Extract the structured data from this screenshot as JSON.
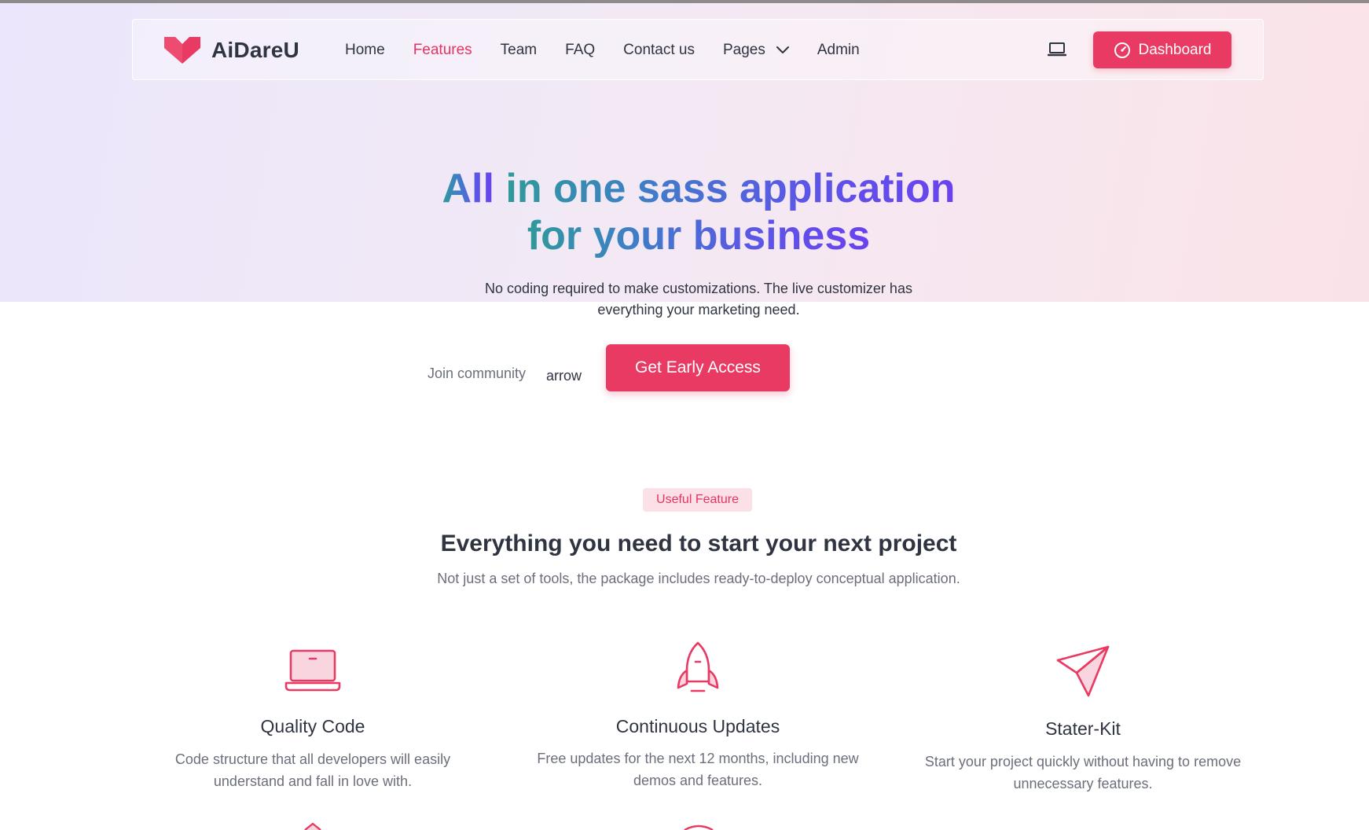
{
  "brand": {
    "name": "AiDareU",
    "accent": "#e83a62"
  },
  "nav": {
    "items": [
      {
        "label": "Home",
        "active": false
      },
      {
        "label": "Features",
        "active": true
      },
      {
        "label": "Team",
        "active": false
      },
      {
        "label": "FAQ",
        "active": false
      },
      {
        "label": "Contact us",
        "active": false
      },
      {
        "label": "Pages",
        "active": false,
        "dropdown": true
      },
      {
        "label": "Admin",
        "active": false
      }
    ],
    "device_icon": "laptop-icon",
    "dashboard_label": "Dashboard",
    "dashboard_icon": "gauge-icon"
  },
  "hero": {
    "title_line1_part1": "All",
    "title_line1_part2": "in one sass application",
    "title_line2": "for your business",
    "subtitle_line1": "No coding required to make customizations. The live customizer has",
    "subtitle_line2": "everything your marketing need.",
    "join_label": "Join community",
    "arrow_label": "arrow",
    "cta_label": "Get Early Access"
  },
  "features": {
    "badge": "Useful Feature",
    "title_bold": "Everything you need",
    "title_rest": "to start your next project",
    "subtitle": "Not just a set of tools, the package includes ready-to-deploy conceptual application.",
    "items": [
      {
        "icon": "laptop-icon",
        "title": "Quality Code",
        "desc_line1": "Code structure that all developers will easily",
        "desc_line2": "understand and fall in love with."
      },
      {
        "icon": "rocket-icon",
        "title": "Continuous Updates",
        "desc_line1": "Free updates for the next 12 months, including new",
        "desc_line2": "demos and features."
      },
      {
        "icon": "paper-plane-icon",
        "title": "Stater-Kit",
        "desc_line1": "Start your project quickly without having to remove",
        "desc_line2": "unnecessary features."
      }
    ]
  }
}
